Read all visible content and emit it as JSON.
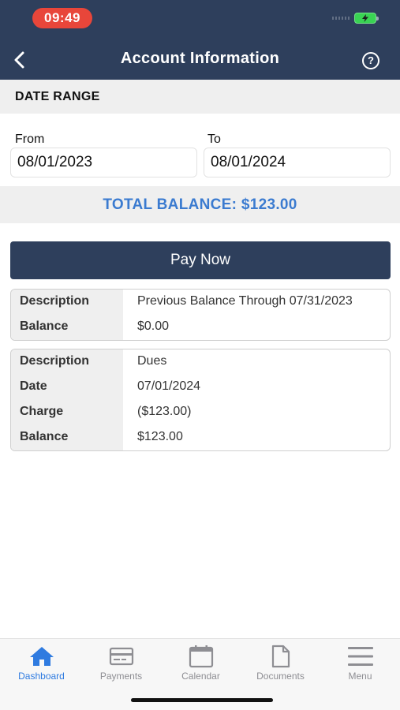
{
  "status_bar": {
    "time": "09:49"
  },
  "header": {
    "title": "Account Information",
    "help_symbol": "?"
  },
  "date_range": {
    "heading": "DATE RANGE",
    "from_label": "From",
    "from_value": "08/01/2023",
    "to_label": "To",
    "to_value": "08/01/2024"
  },
  "total_balance": "TOTAL BALANCE: $123.00",
  "pay_now_label": "Pay Now",
  "entries": [
    {
      "rows": [
        {
          "key": "Description",
          "value": "Previous Balance Through 07/31/2023"
        },
        {
          "key": "Balance",
          "value": "$0.00"
        }
      ]
    },
    {
      "rows": [
        {
          "key": "Description",
          "value": "Dues"
        },
        {
          "key": "Date",
          "value": "07/01/2024"
        },
        {
          "key": "Charge",
          "value": "($123.00)"
        },
        {
          "key": "Balance",
          "value": "$123.00"
        }
      ]
    }
  ],
  "tabs": [
    {
      "label": "Dashboard",
      "icon": "home-icon",
      "active": true
    },
    {
      "label": "Payments",
      "icon": "credit-card-icon",
      "active": false
    },
    {
      "label": "Calendar",
      "icon": "calendar-icon",
      "active": false
    },
    {
      "label": "Documents",
      "icon": "document-icon",
      "active": false
    },
    {
      "label": "Menu",
      "icon": "menu-icon",
      "active": false
    }
  ],
  "colors": {
    "header": "#2e3f5c",
    "accent_blue": "#3b7bd0",
    "active_tab": "#2f7be0",
    "time_pill": "#e8463a"
  }
}
